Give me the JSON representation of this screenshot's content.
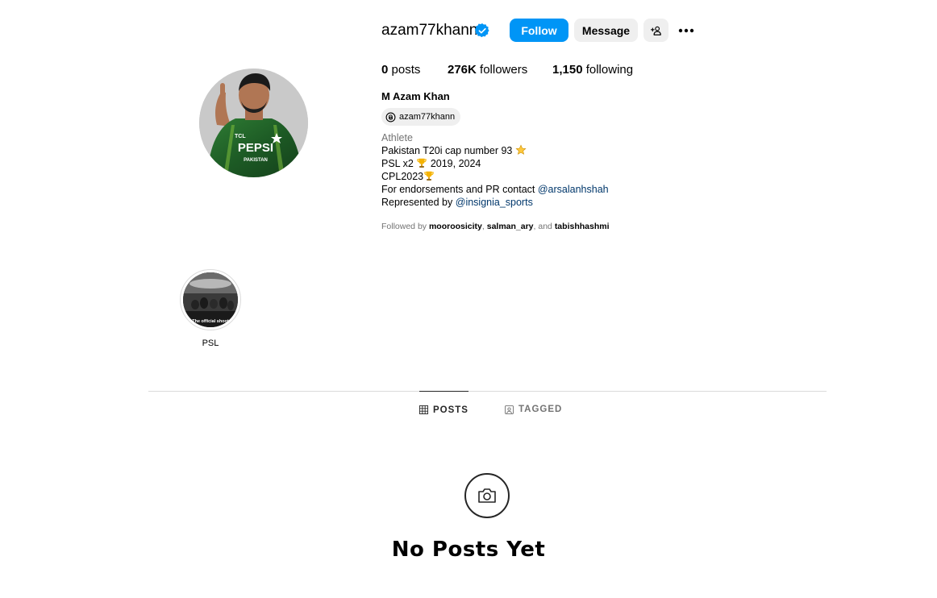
{
  "profile": {
    "username": "azam77khann",
    "verified": true,
    "full_name": "M Azam Khan",
    "threads_handle": "azam77khann",
    "category": "Athlete",
    "bio_lines": [
      "Pakistan T20i cap number 93",
      "PSL x2",
      "2019, 2024",
      "CPL2023",
      "For endorsements and PR contact",
      "@arsalanhshah",
      "Represented by",
      "@insignia_sports"
    ],
    "avatar_jersey_text": "PEPSI",
    "avatar_jersey_sub": "PAKISTAN"
  },
  "actions": {
    "follow_label": "Follow",
    "message_label": "Message",
    "add_user_icon": "add-user-icon",
    "more_icon": "more-options-icon"
  },
  "stats": {
    "posts_count": "0",
    "posts_label": "posts",
    "followers_count": "276K",
    "followers_label": "followers",
    "following_count": "1,150",
    "following_label": "following"
  },
  "followed_by": {
    "prefix": "Followed by",
    "users": [
      "mooroosicity",
      "salman_ary",
      "tabishhashmi"
    ],
    "separator_comma": ",",
    "separator_and": ", and"
  },
  "highlights": [
    {
      "label": "PSL",
      "cover_caption": "The official shoot"
    }
  ],
  "tabs": [
    {
      "label": "POSTS",
      "icon": "grid-icon",
      "active": true
    },
    {
      "label": "TAGGED",
      "icon": "tagged-icon",
      "active": false
    }
  ],
  "empty_state": {
    "icon": "camera-icon",
    "title": "No Posts Yet"
  },
  "colors": {
    "follow_button": "#0095f6",
    "secondary_button": "#efefef",
    "verified_badge": "#0095f6",
    "mention_link": "#00376b",
    "muted_text": "#737373",
    "jersey_green": "#1f5c2a"
  }
}
